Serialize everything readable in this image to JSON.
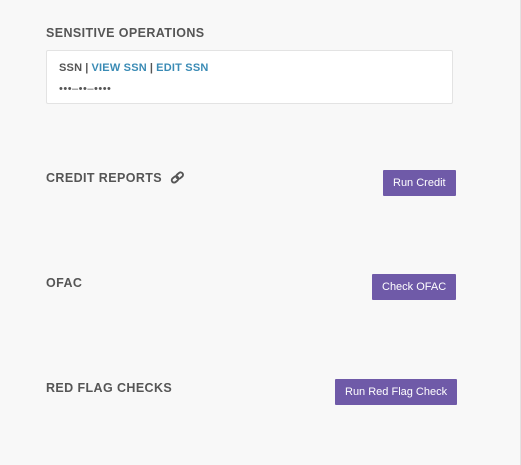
{
  "sensitive_operations": {
    "title": "SENSITIVE OPERATIONS",
    "ssn_label": "SSN",
    "separator": "|",
    "view_ssn_label": "VIEW SSN",
    "edit_ssn_label": "EDIT SSN",
    "ssn_masked_value": "•••–••–••••"
  },
  "credit_reports": {
    "title": "CREDIT REPORTS",
    "icon": "link-icon",
    "button_label": "Run Credit"
  },
  "ofac": {
    "title": "OFAC",
    "button_label": "Check OFAC"
  },
  "red_flag_checks": {
    "title": "RED FLAG CHECKS",
    "button_label": "Run Red Flag Check"
  },
  "colors": {
    "button_bg": "#6f5aa8",
    "link": "#3a8bb5",
    "text": "#555555",
    "page_bg": "#f8f8f8"
  }
}
